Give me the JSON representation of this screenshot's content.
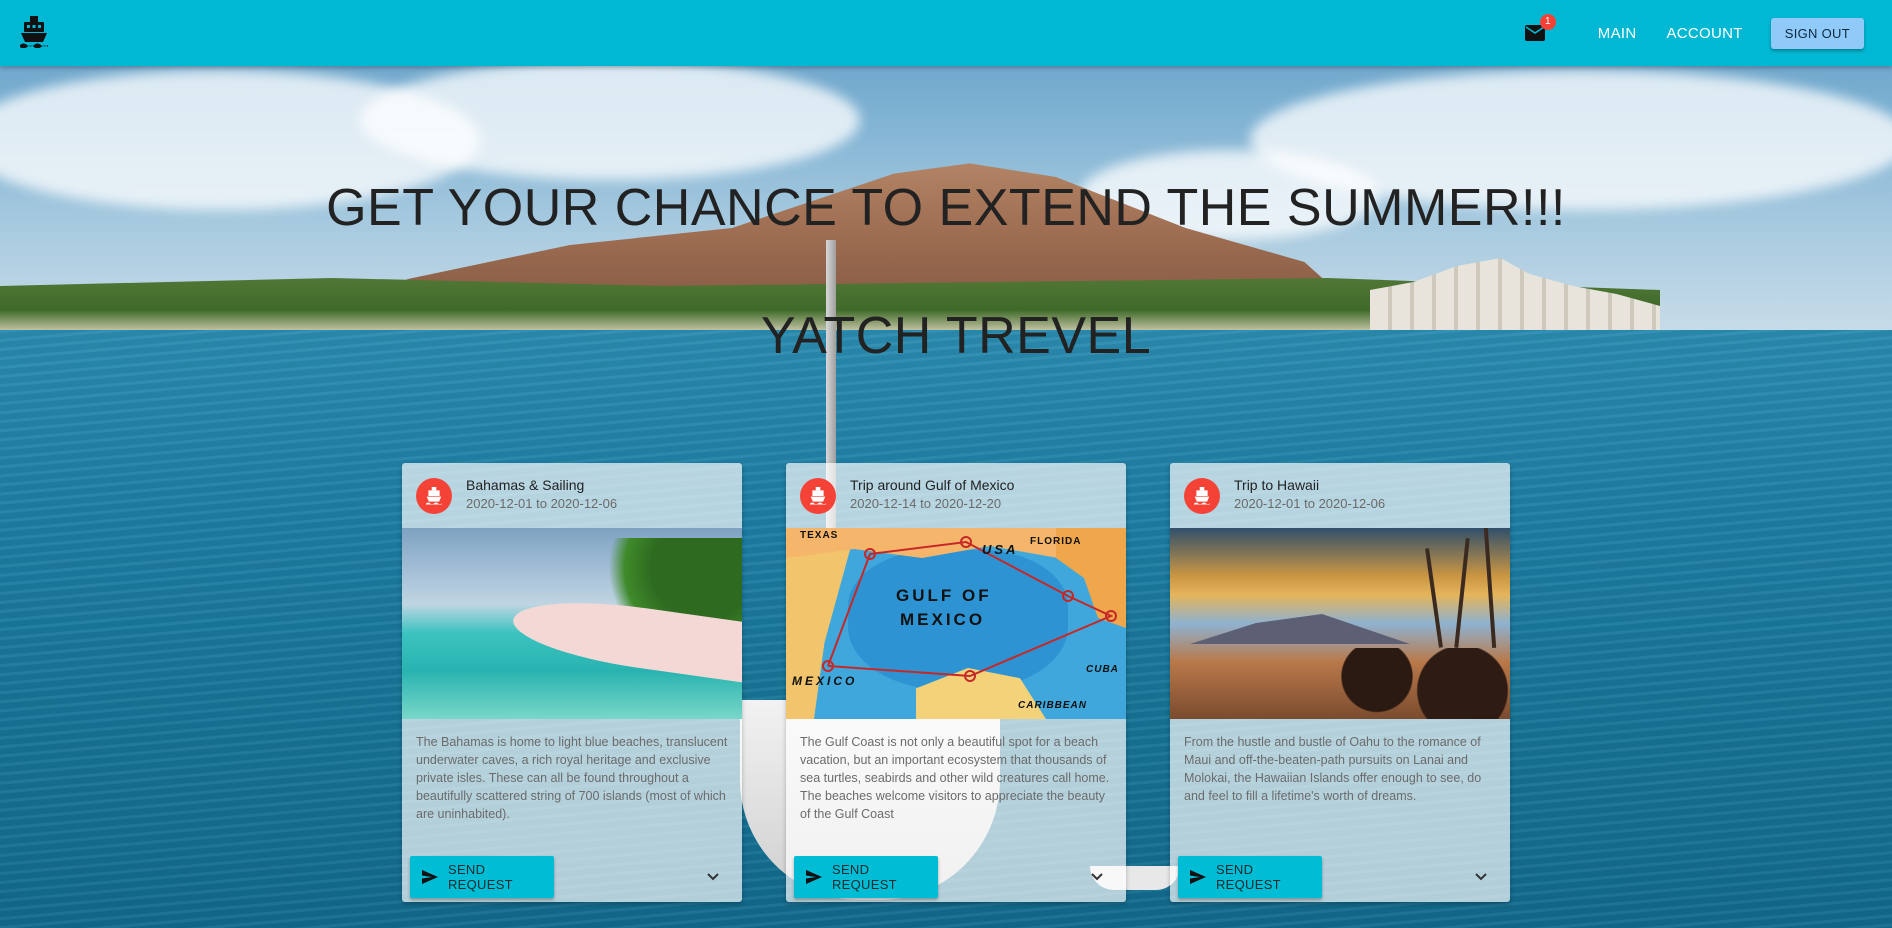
{
  "nav": {
    "notifications_count": "1",
    "main_label": "MAIN",
    "account_label": "ACCOUNT",
    "signout_label": "SIGN OUT"
  },
  "hero": {
    "headline": "GET YOUR CHANCE TO EXTEND THE SUMMER!!!",
    "subheadline": "YATCH TREVEL"
  },
  "colors": {
    "appbar": "#00b8d4",
    "avatar": "#f44336",
    "send_button": "#00bcd4",
    "signout_button": "#90caf9"
  },
  "cards": [
    {
      "title": "Bahamas & Sailing",
      "dates": "2020-12-01 to 2020-12-06",
      "description": "The Bahamas is home to light blue beaches, translucent underwater caves, a rich royal heritage and exclusive private isles. These can all be found throughout a beautifully scattered string of 700 islands (most of which are uninhabited).",
      "button_label": "SEND REQUEST",
      "icon": "ship-icon"
    },
    {
      "title": "Trip around Gulf of Mexico",
      "dates": "2020-12-14 to 2020-12-20",
      "description": "The Gulf Coast is not only a beautiful spot for a beach vacation, but an important ecosystem that thousands of sea turtles, seabirds and other wild creatures call home. The beaches welcome visitors to appreciate the beauty of the Gulf Coast",
      "button_label": "SEND REQUEST",
      "icon": "ship-icon",
      "map_labels": {
        "gulf1": "GULF OF",
        "gulf2": "MEXICO",
        "usa": "USA",
        "mexico": "MEXICO",
        "florida": "FLORIDA",
        "texas": "TEXAS",
        "cuba": "CUBA",
        "caribbean": "CARIBBEAN"
      }
    },
    {
      "title": "Trip to Hawaii",
      "dates": "2020-12-01 to 2020-12-06",
      "description": "From the hustle and bustle of Oahu to the romance of Maui and off-the-beaten-path pursuits on Lanai and Molokai, the Hawaiian Islands offer enough to see, do and feel to fill a lifetime's worth of dreams.",
      "button_label": "SEND REQUEST",
      "icon": "ship-icon"
    }
  ]
}
